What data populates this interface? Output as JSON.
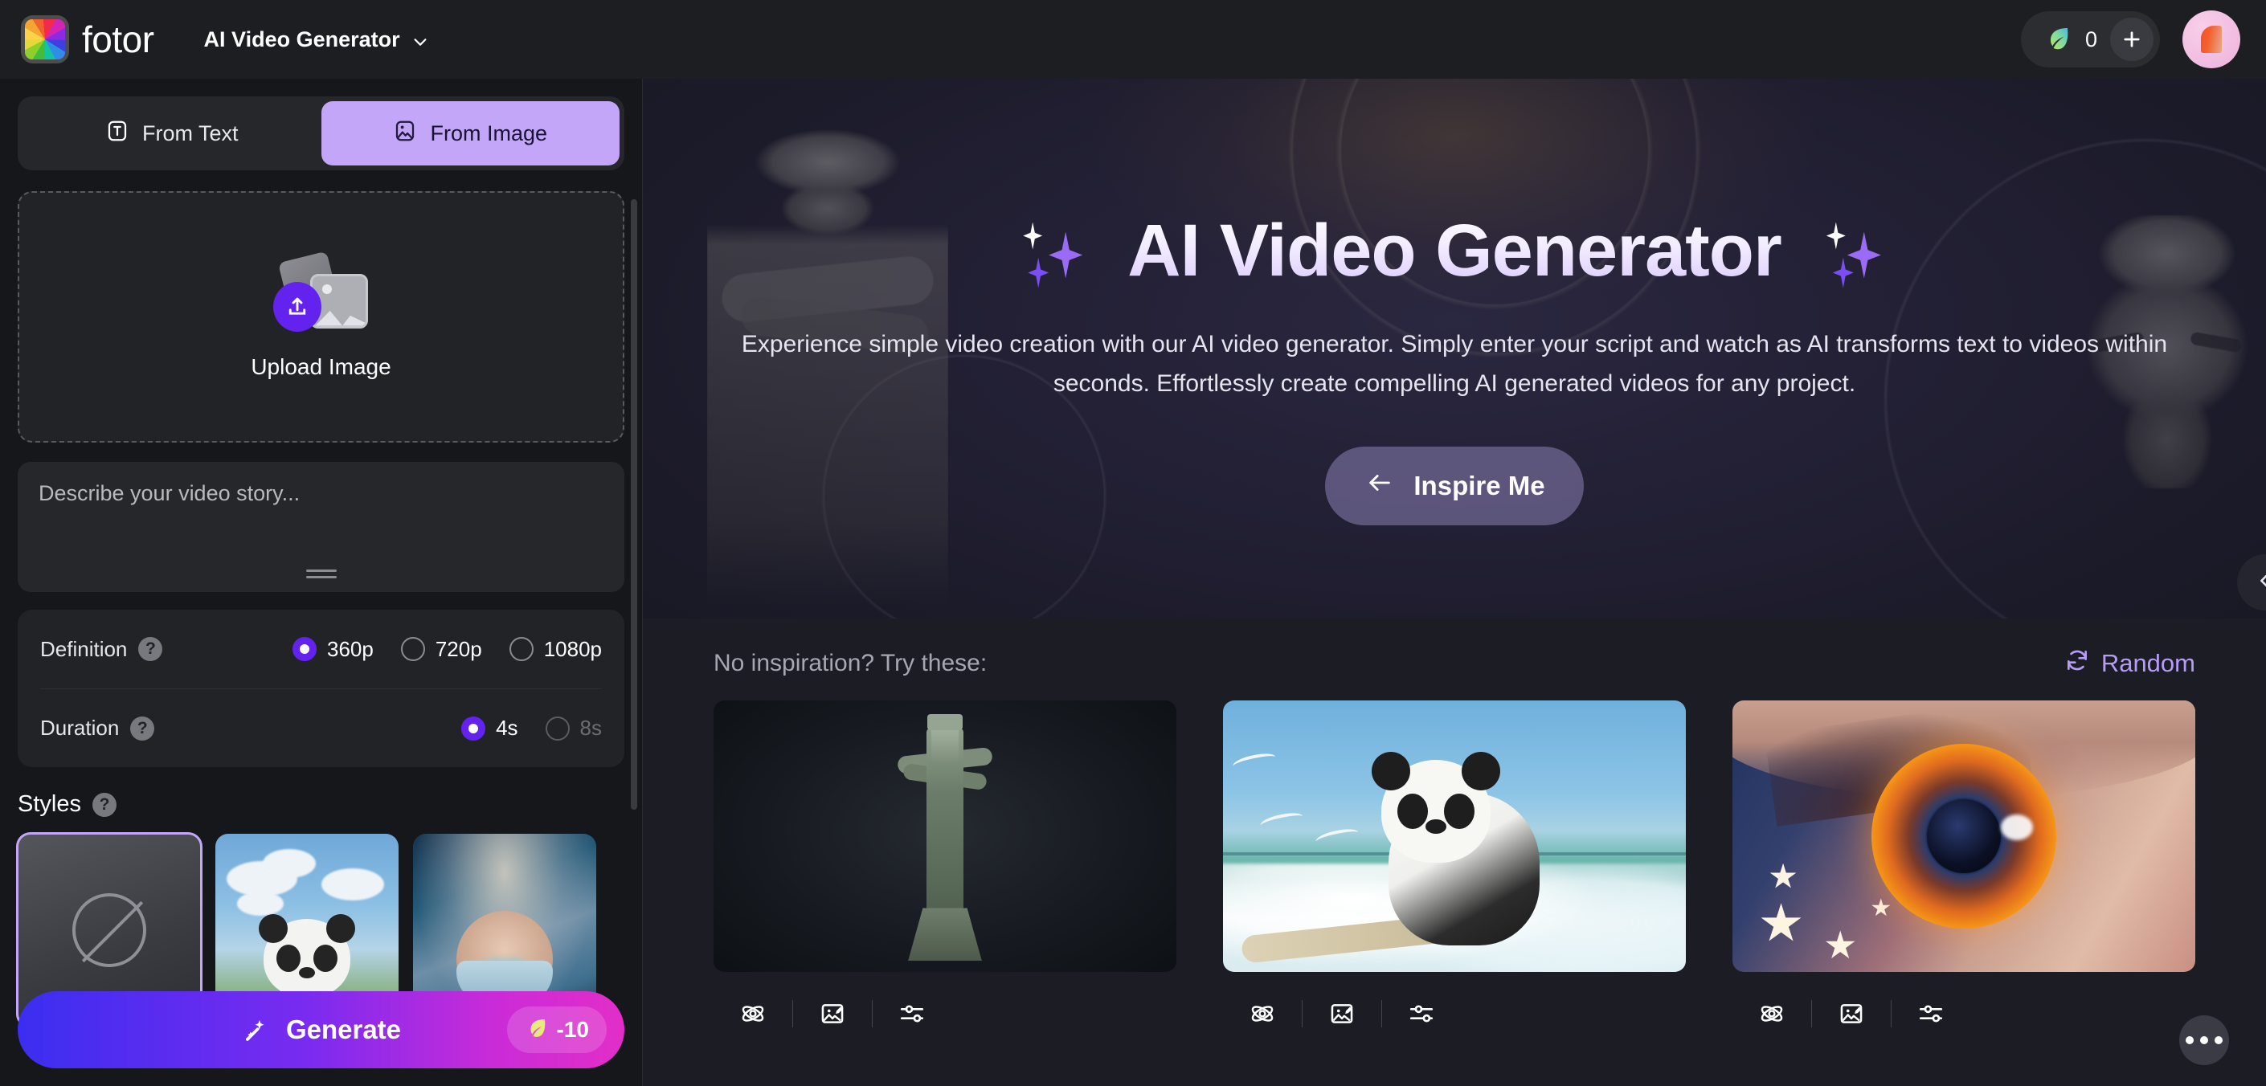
{
  "topbar": {
    "brand_name": "fotor",
    "logo_icon": "fotor-color-wheel-logo",
    "app_switcher_label": "AI Video Generator",
    "chevron_icon": "chevron-down-icon",
    "credits": {
      "leaf_icon": "leaf-credit-icon",
      "count": "0",
      "add_icon": "plus-icon"
    },
    "avatar_label": "user-avatar"
  },
  "left_panel": {
    "tabs": [
      {
        "label": "From Text",
        "icon": "text-box-icon",
        "active": false
      },
      {
        "label": "From Image",
        "icon": "image-box-icon",
        "active": true
      }
    ],
    "upload": {
      "label": "Upload Image",
      "icon": "image-stack-upload-icon"
    },
    "story": {
      "placeholder": "Describe your video story...",
      "value": ""
    },
    "definition": {
      "label": "Definition",
      "help_icon": "help-circle-icon",
      "options": [
        {
          "label": "360p",
          "selected": true,
          "disabled": false
        },
        {
          "label": "720p",
          "selected": false,
          "disabled": false
        },
        {
          "label": "1080p",
          "selected": false,
          "disabled": false
        }
      ]
    },
    "duration": {
      "label": "Duration",
      "help_icon": "help-circle-icon",
      "options": [
        {
          "label": "4s",
          "selected": true,
          "disabled": false
        },
        {
          "label": "8s",
          "selected": false,
          "disabled": true
        }
      ]
    },
    "styles": {
      "label": "Styles",
      "help_icon": "help-circle-icon",
      "items": [
        {
          "name": "none",
          "selected": true
        },
        {
          "name": "panda-clouds",
          "selected": false
        },
        {
          "name": "cyber-girl",
          "selected": false
        }
      ]
    },
    "generate": {
      "label": "Generate",
      "icon": "magic-wand-icon",
      "cost_icon": "leaf-credit-icon",
      "cost": "-10"
    }
  },
  "hero": {
    "title": "AI Video Generator",
    "sparkle_icon": "sparkle-diamond-icon",
    "subtitle": "Experience simple video creation with our AI video generator. Simply enter your script and watch as AI transforms text to videos within seconds. Effortlessly create compelling AI generated videos for any project.",
    "cta": {
      "label": "Inspire Me",
      "icon": "arrow-left-icon"
    }
  },
  "gallery": {
    "heading": "No inspiration? Try these:",
    "random": {
      "label": "Random",
      "icon": "refresh-icon"
    },
    "card_actions": [
      {
        "icon": "atom-magic-icon"
      },
      {
        "icon": "image-edit-icon"
      },
      {
        "icon": "sliders-settings-icon"
      }
    ],
    "cards": [
      {
        "name": "bronze-statue-card"
      },
      {
        "name": "surfing-panda-card"
      },
      {
        "name": "cosmic-eye-card"
      }
    ]
  },
  "controls": {
    "collapse_icon": "chevron-left-icon",
    "more_icon": "more-dots-icon"
  },
  "colors": {
    "accent_purple": "#6322ee",
    "tab_active": "#c3a6f7",
    "random_link": "#b79cf6",
    "bg_dark": "#16171a",
    "panel_card": "#222326",
    "generate_from": "#3b2ef0",
    "generate_to": "#e22ec8"
  }
}
